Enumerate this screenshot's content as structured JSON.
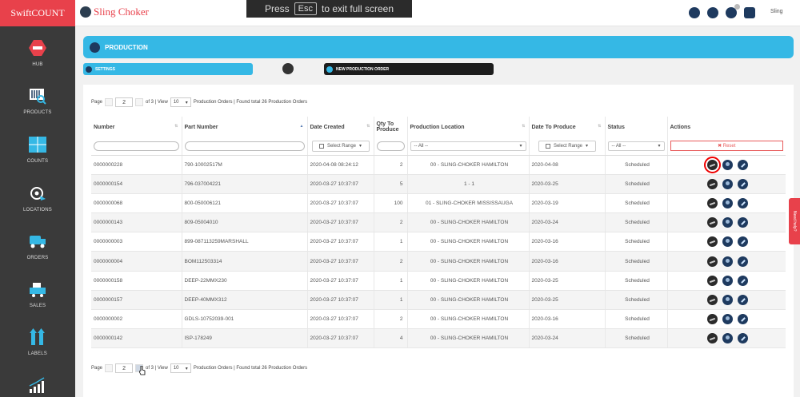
{
  "app": {
    "brand": "SwiftCOUNT",
    "company": "Sling Choker",
    "user": "Sling"
  },
  "fullscreen_banner": {
    "prefix": "Press",
    "key": "Esc",
    "suffix": "to exit full screen"
  },
  "sidebar": {
    "items": [
      {
        "label": "HUB",
        "icon": "hub-icon"
      },
      {
        "label": "PRODUCTS",
        "icon": "barcode-search-icon"
      },
      {
        "label": "COUNTS",
        "icon": "counts-icon"
      },
      {
        "label": "LOCATIONS",
        "icon": "location-icon"
      },
      {
        "label": "ORDERS",
        "icon": "truck-icon"
      },
      {
        "label": "SALES",
        "icon": "sales-icon"
      },
      {
        "label": "LABELS",
        "icon": "labels-icon"
      },
      {
        "label": "",
        "icon": "bar-chart-icon"
      }
    ]
  },
  "header": {
    "title": "PRODUCTION",
    "settings": "SETTINGS",
    "new_order": "NEW PRODUCTION ORDER"
  },
  "pager": {
    "page_label": "Page",
    "page": "2",
    "of_label": "of 3 | View",
    "per_page": "10",
    "summary": "Production Orders | Found total 26 Production Orders"
  },
  "table": {
    "columns": [
      "Number",
      "Part Number",
      "Date Created",
      "Qty To Produce",
      "Production Location",
      "Date To Produce",
      "Status",
      "Actions"
    ],
    "filters": {
      "select_range": "Select Range",
      "all": "-- All --",
      "reset": "✖ Reset"
    },
    "rows": [
      {
        "number": "0000000228",
        "part": "790-10002517M",
        "created": "2020-04-08 08:24:12",
        "qty": "2",
        "location": "00 - SLING-CHOKER HAMILTON",
        "produce": "2020-04-08",
        "status": "Scheduled"
      },
      {
        "number": "0000000154",
        "part": "796-037004221",
        "created": "2020-03-27 10:37:07",
        "qty": "5",
        "location": "1 - 1",
        "produce": "2020-03-25",
        "status": "Scheduled"
      },
      {
        "number": "0000000068",
        "part": "800-050006121",
        "created": "2020-03-27 10:37:07",
        "qty": "100",
        "location": "01 - SLING-CHOKER MISSISSAUGA",
        "produce": "2020-03-19",
        "status": "Scheduled"
      },
      {
        "number": "0000000143",
        "part": "809-05004010",
        "created": "2020-03-27 10:37:07",
        "qty": "2",
        "location": "00 - SLING-CHOKER HAMILTON",
        "produce": "2020-03-24",
        "status": "Scheduled"
      },
      {
        "number": "0000000003",
        "part": "899-087113259MARSHALL",
        "created": "2020-03-27 10:37:07",
        "qty": "1",
        "location": "00 - SLING-CHOKER HAMILTON",
        "produce": "2020-03-16",
        "status": "Scheduled"
      },
      {
        "number": "0000000004",
        "part": "BOM112503314",
        "created": "2020-03-27 10:37:07",
        "qty": "2",
        "location": "00 - SLING-CHOKER HAMILTON",
        "produce": "2020-03-16",
        "status": "Scheduled"
      },
      {
        "number": "0000000158",
        "part": "DEEP-22MMX230",
        "created": "2020-03-27 10:37:07",
        "qty": "1",
        "location": "00 - SLING-CHOKER HAMILTON",
        "produce": "2020-03-25",
        "status": "Scheduled"
      },
      {
        "number": "0000000157",
        "part": "DEEP-40MMX312",
        "created": "2020-03-27 10:37:07",
        "qty": "1",
        "location": "00 - SLING-CHOKER HAMILTON",
        "produce": "2020-03-25",
        "status": "Scheduled"
      },
      {
        "number": "0000000002",
        "part": "GDLS-10752039-001",
        "created": "2020-03-27 10:37:07",
        "qty": "2",
        "location": "00 - SLING-CHOKER HAMILTON",
        "produce": "2020-03-16",
        "status": "Scheduled"
      },
      {
        "number": "0000000142",
        "part": "ISP-178249",
        "created": "2020-03-27 10:37:07",
        "qty": "4",
        "location": "00 - SLING-CHOKER HAMILTON",
        "produce": "2020-03-24",
        "status": "Scheduled"
      }
    ]
  },
  "need_help": "Need help?"
}
